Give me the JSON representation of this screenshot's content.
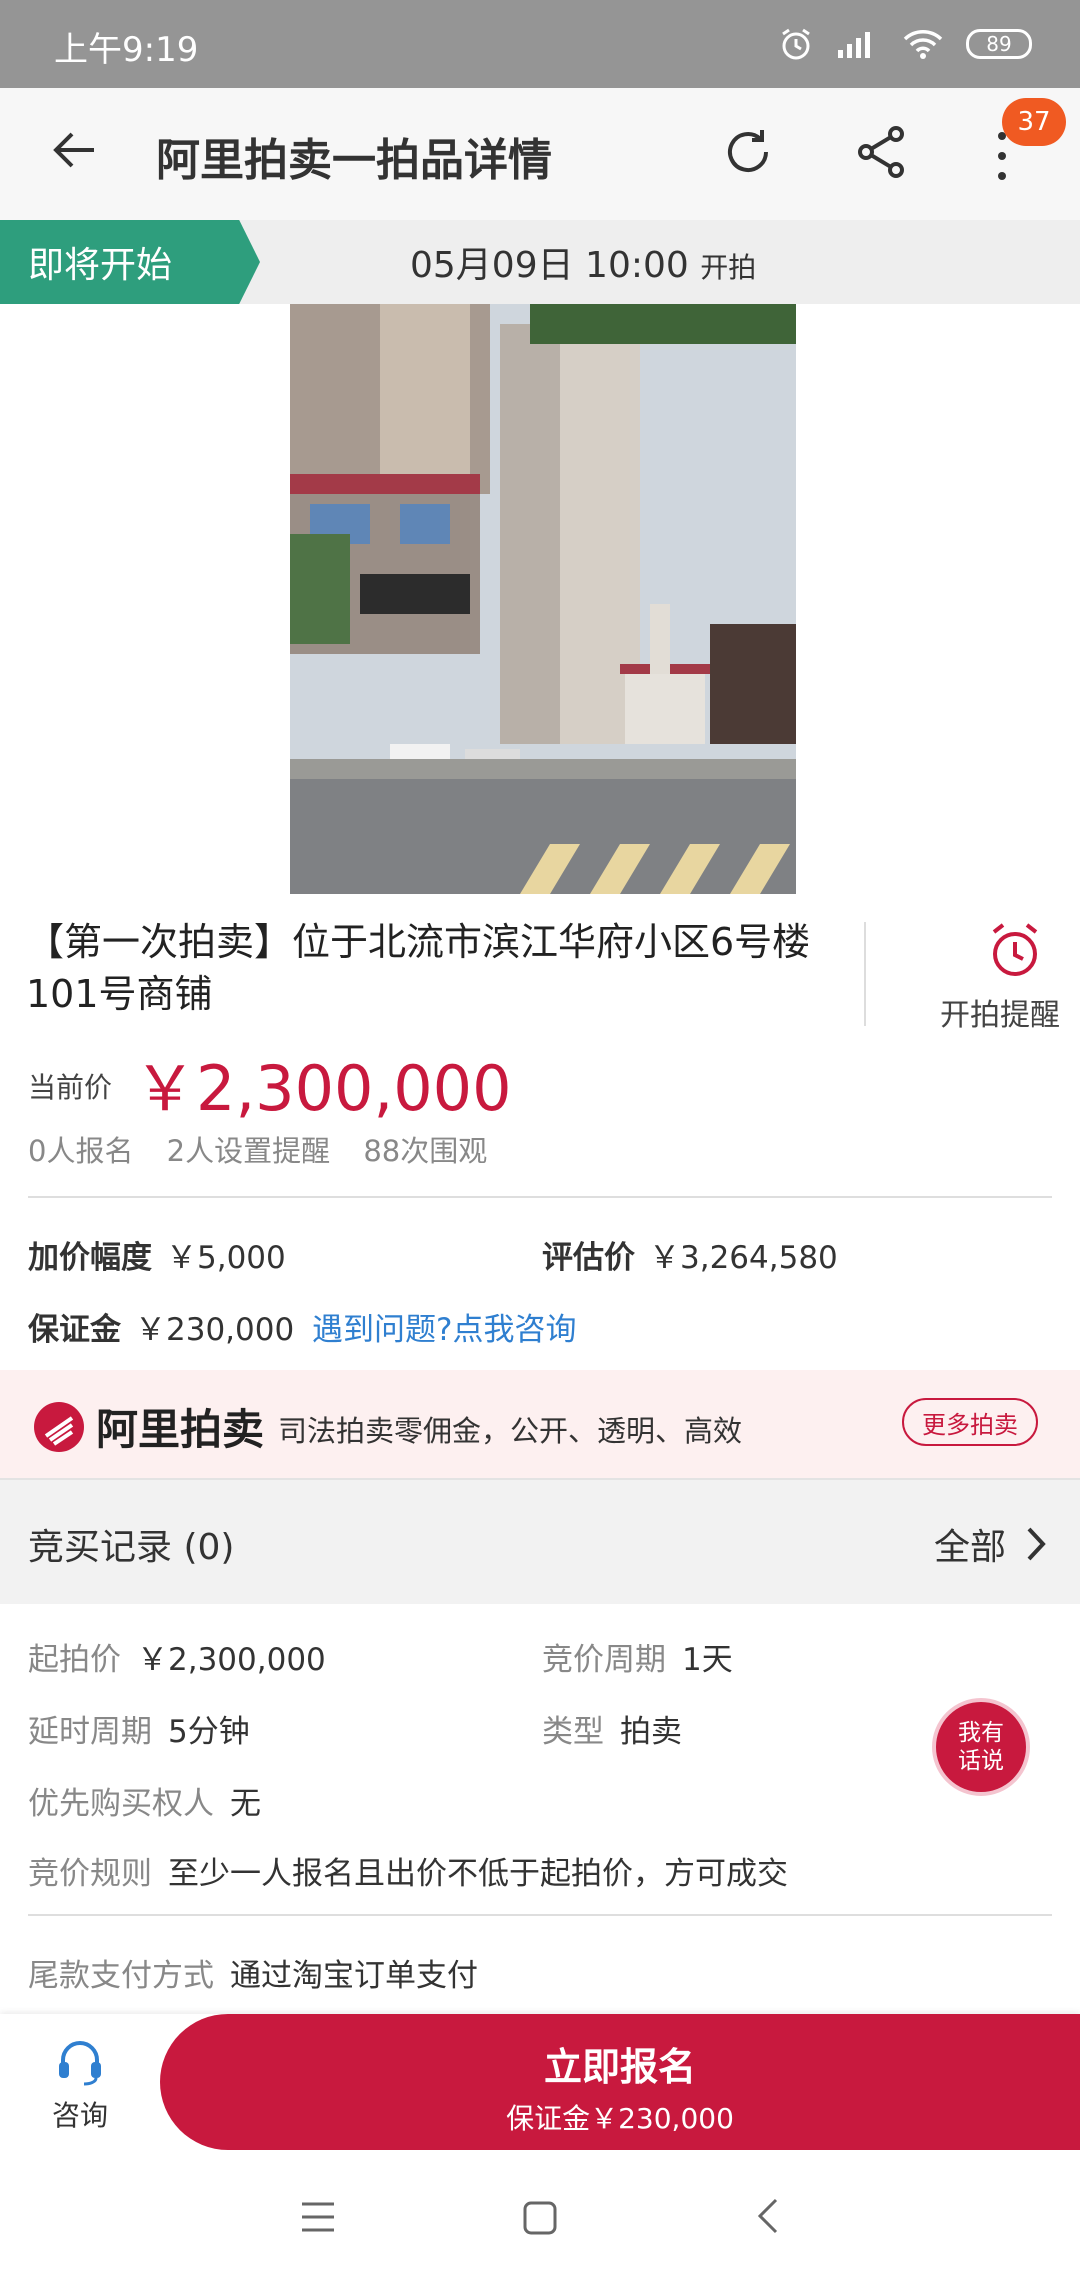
{
  "status_bar": {
    "time": "上午9:19",
    "battery": "89"
  },
  "header": {
    "title": "阿里拍卖一拍品详情",
    "badge_count": "37"
  },
  "banner": {
    "status": "即将开始",
    "date_time": "05月09日 10:00",
    "suffix": "开拍"
  },
  "item": {
    "title": "【第一次拍卖】位于北流市滨江华府小区6号楼101号商铺",
    "remind_label": "开拍提醒",
    "price_label": "当前价",
    "price": "￥2,300,000",
    "stats": [
      "0人报名",
      "2人设置提醒",
      "88次围观"
    ]
  },
  "terms": {
    "increment_label": "加价幅度",
    "increment_value": "￥5,000",
    "evaluation_label": "评估价",
    "evaluation_value": "￥3,264,580",
    "deposit_label": "保证金",
    "deposit_value": "￥230,000",
    "consult_link": "遇到问题?点我咨询"
  },
  "ali_banner": {
    "brand": "阿里拍卖",
    "slogan": "司法拍卖零佣金，公开、透明、高效",
    "more": "更多拍卖"
  },
  "bid_records": {
    "title": "竞买记录",
    "count": "(0)",
    "all": "全部"
  },
  "details": {
    "start_price_label": "起拍价",
    "start_price_value": "￥2,300,000",
    "period_label": "竞价周期",
    "period_value": "1天",
    "delay_label": "延时周期",
    "delay_value": "5分钟",
    "type_label": "类型",
    "type_value": "拍卖",
    "priority_label": "优先购买权人",
    "priority_value": "无",
    "rule_label": "竞价规则",
    "rule_value": "至少一人报名且出价不低于起拍价，方可成交",
    "pay_label": "尾款支付方式",
    "pay_value": "通过淘宝订单支付"
  },
  "float_chat": {
    "line1": "我有",
    "line2": "话说"
  },
  "bottom_bar": {
    "consult": "咨询",
    "signup": "立即报名",
    "signup_sub": "保证金￥230,000"
  },
  "colors": {
    "brand_red": "#c8193e",
    "status_green": "#2e9e7d",
    "badge_orange": "#f05a22",
    "link_blue": "#2f7fd0"
  }
}
